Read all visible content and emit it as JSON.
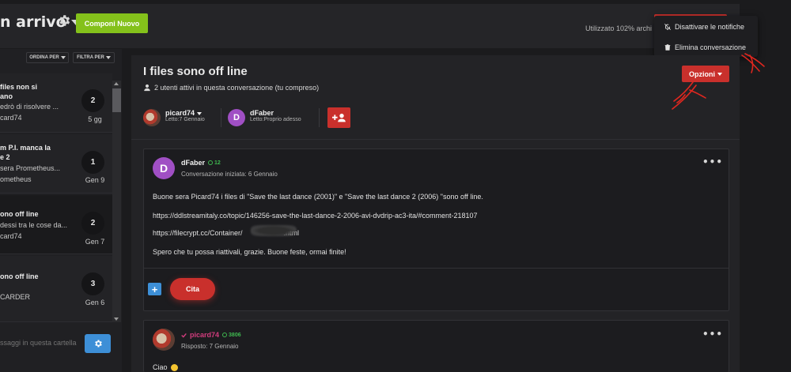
{
  "header": {
    "folder_title": "n arrivo",
    "compose_label": "Componi Nuovo",
    "usage_text": "Utilizzato 102% archi"
  },
  "dropdown": {
    "items": [
      {
        "label": "Disattivare le notifiche",
        "icon": "bell-off-icon"
      },
      {
        "label": "Elimina conversazione",
        "icon": "trash-icon"
      }
    ]
  },
  "sidebar": {
    "sort_label": "ORDINA PER",
    "filter_label": "FILTRA PER",
    "conversations": [
      {
        "title_1": "files non si",
        "title_2": "ano",
        "snippet": "edrò di risolvere ...",
        "author": "card74",
        "count": "2",
        "date": "5 gg"
      },
      {
        "title_1": "m P.I. manca la",
        "title_2": "e 2",
        "snippet": "sera Prometheus...",
        "author": "ometheus",
        "count": "1",
        "date": "Gen 9"
      },
      {
        "title_1": "ono off line",
        "title_2": "",
        "snippet": "dessi tra le cose da...",
        "author": "card74",
        "count": "2",
        "date": "Gen 7"
      },
      {
        "title_1": "ono off line",
        "title_2": "",
        "snippet": "",
        "author": "CARDER",
        "count": "3",
        "date": "Gen 6"
      }
    ],
    "search_placeholder": "ssaggi in questa cartella"
  },
  "conversation": {
    "title": "I files sono off line",
    "active_users": "2 utenti attivi in questa conversazione (tu compreso)",
    "options_label": "Opzioni",
    "participants": [
      {
        "name": "picard74",
        "status": "Letto:7 Gennaio"
      },
      {
        "name": "dFaber",
        "status": "Letto:Proprio adesso",
        "initial": "D"
      }
    ]
  },
  "posts": [
    {
      "author": "dFaber",
      "initial": "D",
      "reputation": "12",
      "meta": "Conversazione iniziata: 6 Gennaio",
      "lines": [
        "Buone sera Picard74 i files di \"Save the last dance (2001)\"  e \"Save the last dance 2 (2006) \"sono off line.",
        "https://ddlstreamitaly.co/topic/146256-save-the-last-dance-2-2006-avi-dvdrip-ac3-ita/#comment-218107",
        "https://filecrypt.cc/Container/",
        ".html",
        "Spero che tu possa riattivali, grazie. Buone feste, ormai finite!"
      ],
      "quote_label": "Cita",
      "more_label": "+"
    },
    {
      "author": "picard74",
      "reputation": "3806",
      "meta": "Risposto: 7 Gennaio",
      "lines": [
        "Ciao"
      ]
    }
  ],
  "colors": {
    "accent_red": "#c9302c",
    "accent_green": "#84c11b",
    "accent_blue": "#3d8fd7",
    "avatar_purple": "#a04fc4",
    "rep_green": "#3fb950",
    "author_pink": "#d23c7d"
  }
}
